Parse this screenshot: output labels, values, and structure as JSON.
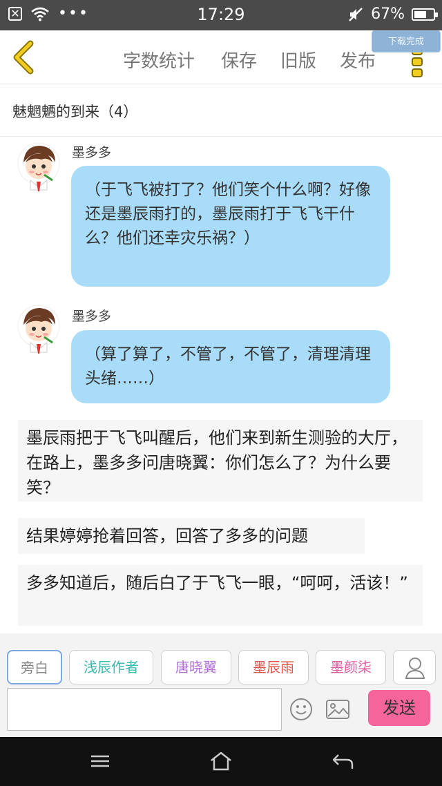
{
  "status": {
    "x_label": "✕",
    "dots": "•••",
    "time": "17:29",
    "battery_pct": "67%",
    "battery_level": 0.67
  },
  "header": {
    "menu": [
      "字数统计",
      "保存",
      "旧版",
      "发布"
    ],
    "toast": "下载完成"
  },
  "chapter_title": "魅魍魉的到来（4）",
  "messages": [
    {
      "speaker": "墨多多",
      "text": "（于飞飞被打了？他们笑个什么啊？好像还是墨辰雨打的，墨辰雨打于飞飞干什么？他们还幸灾乐祸？）"
    },
    {
      "speaker": "墨多多",
      "text": "（算了算了，不管了，不管了，清理清理头绪……）"
    }
  ],
  "narration": [
    "墨辰雨把于飞飞叫醒后，他们来到新生测验的大厅，在路上，墨多多问唐晓翼：你们怎么了？为什么要笑？",
    "结果婷婷抢着回答，回答了多多的问题",
    "多多知道后，随后白了于飞飞一眼，“呵呵，活该！”"
  ],
  "characters": [
    {
      "label": "旁白",
      "color": "#888888"
    },
    {
      "label": "浅辰作者",
      "color": "#3bb8b0"
    },
    {
      "label": "唐晓翼",
      "color": "#b071d6"
    },
    {
      "label": "墨辰雨",
      "color": "#e0524a"
    },
    {
      "label": "墨颜柒",
      "color": "#e05aa0"
    }
  ],
  "input": {
    "placeholder": ""
  },
  "send_label": "发送",
  "icons": [
    "close-icon",
    "wifi-icon",
    "mute-icon",
    "battery-icon",
    "back-icon",
    "more-icon",
    "user-icon",
    "emoji-icon",
    "image-icon",
    "menu-icon",
    "home-icon",
    "return-icon"
  ],
  "colors": {
    "accent": "#f5649a",
    "bubble": "#a9dcf8",
    "back_icon": "#e8c400"
  }
}
